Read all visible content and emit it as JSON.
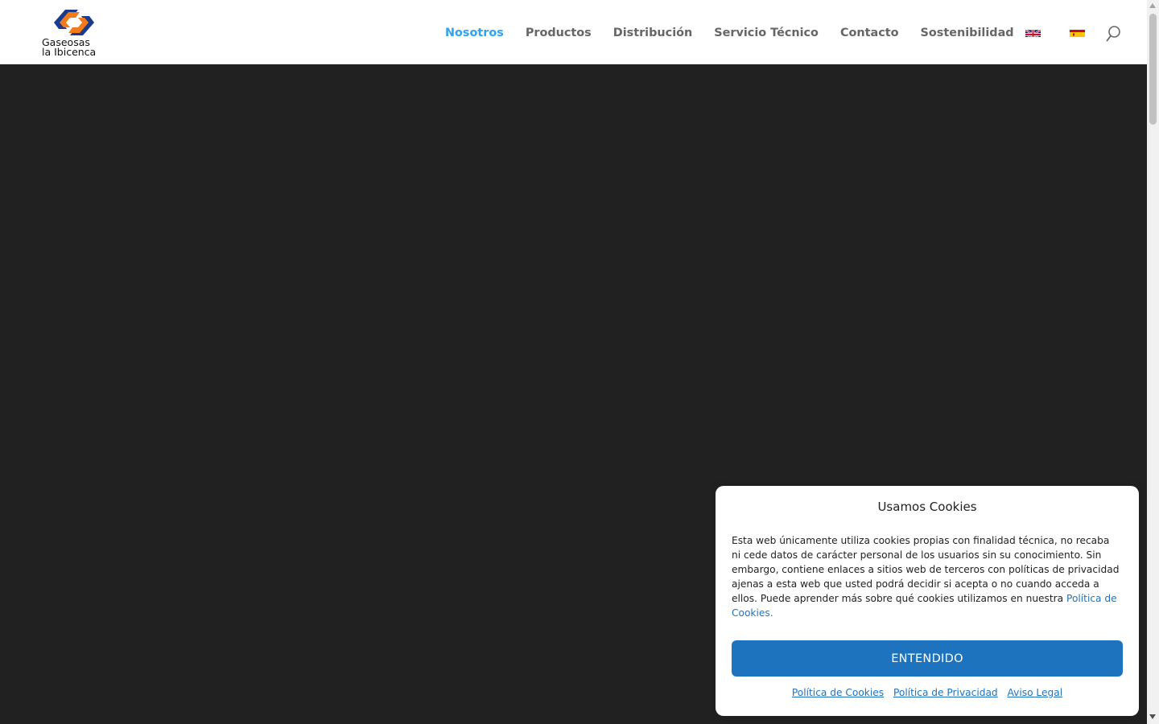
{
  "brand": {
    "name_line1": "Gaseosas",
    "name_line2": "la Ibicenca",
    "logo_icon": "gaseosas-logo-icon"
  },
  "nav": {
    "items": [
      {
        "label": "Nosotros",
        "active": true
      },
      {
        "label": "Productos",
        "active": false
      },
      {
        "label": "Distribución",
        "active": false
      },
      {
        "label": "Servicio Técnico",
        "active": false
      },
      {
        "label": "Contacto",
        "active": false
      },
      {
        "label": "Sostenibilidad",
        "active": false
      }
    ],
    "languages": [
      {
        "icon": "flag-uk-icon"
      },
      {
        "icon": "flag-spain-icon"
      }
    ],
    "search_icon": "search-icon"
  },
  "cookie_banner": {
    "title": "Usamos Cookies",
    "body": "Esta web únicamente utiliza cookies propias con finalidad técnica, no recaba ni cede datos de carácter personal de los usuarios sin su conocimiento. Sin embargo, contiene enlaces a sitios web de terceros con políticas de privacidad ajenas a esta web que usted podrá decidir si acepta o no cuando acceda a ellos. Puede aprender más sobre qué cookies utilizamos en nuestra ",
    "body_link": "Política de Cookies.",
    "accept_label": "ENTENDIDO",
    "links": [
      "Política de Cookies",
      "Política de Privacidad",
      "Aviso Legal"
    ]
  },
  "colors": {
    "accent": "#2ea3f2",
    "nav_text": "#666666",
    "hero_background": "#212121",
    "button": "#1e73be",
    "logo_orange": "#f27a1a",
    "logo_blue": "#1b3a8c"
  }
}
